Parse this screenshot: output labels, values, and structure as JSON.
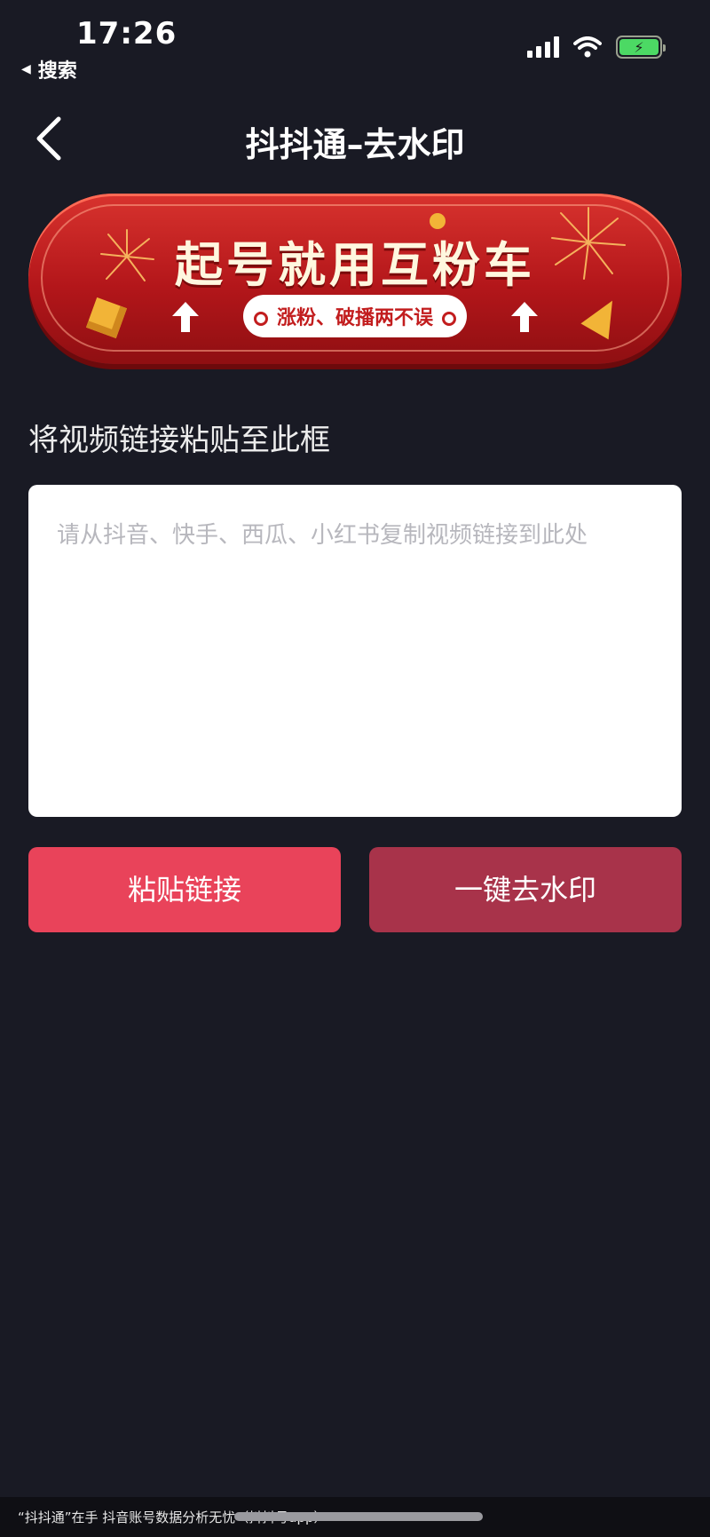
{
  "status_bar": {
    "time": "17:26",
    "back_app": "搜索",
    "battery_charging_glyph": "⚡",
    "icons": [
      "signal-icon",
      "wifi-icon",
      "battery-icon"
    ]
  },
  "nav": {
    "title": "抖抖通–去水印",
    "back_icon": "chevron-left-icon"
  },
  "banner": {
    "title": "起号就用互粉车",
    "subtitle": "涨粉、破播两不误",
    "colors": {
      "background": "#c21d1e",
      "title": "#fff7df",
      "accent": "#f2b437"
    }
  },
  "main": {
    "label": "将视频链接粘贴至此框",
    "input": {
      "value": "",
      "placeholder": "请从抖音、快手、西瓜、小红书复制视频链接到此处"
    },
    "buttons": {
      "paste": "粘贴链接",
      "remove_watermark": "一键去水印"
    },
    "colors": {
      "paste_button": "#e9435a",
      "remove_button": "#a8334a",
      "background": "#191a24"
    }
  },
  "footer": {
    "ticker": "“抖抖通”在手  抖音账号数据分析无忧（抖抖号app）"
  }
}
